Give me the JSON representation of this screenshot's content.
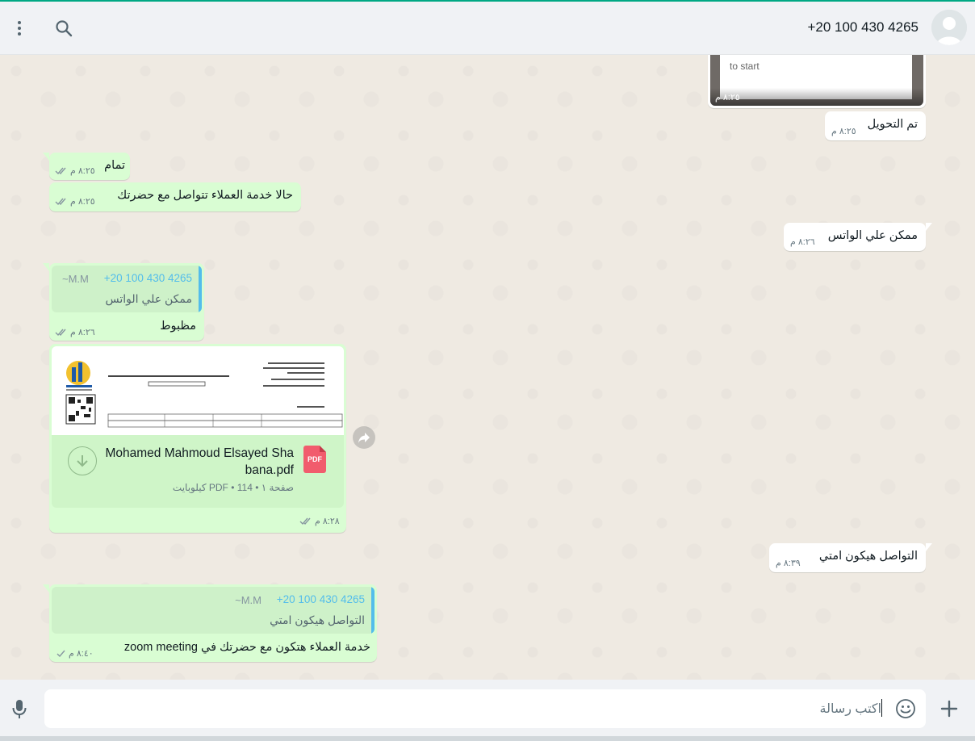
{
  "header": {
    "contact_name": "+20 100 430 4265"
  },
  "icons": {
    "avatar": "default-user-avatar",
    "menu": "kebab-menu-icon",
    "search": "search-icon",
    "mic": "microphone-icon",
    "add": "plus-icon",
    "emoji": "emoji-icon",
    "forward": "forward-icon",
    "download": "download-icon",
    "pdf": "pdf-file-icon",
    "read_receipt": "double-check-icon",
    "sent_receipt": "single-check-icon"
  },
  "colors": {
    "accent": "#00a884",
    "incoming": "#ffffff",
    "outgoing": "#d9fdd3",
    "quote_accent": "#53bdeb",
    "read_tick": "#8696a0",
    "pdf_red": "#f15c6d"
  },
  "messages": {
    "m1": {
      "image_caption": "to start",
      "time": "٨:٢٥ م"
    },
    "m2": {
      "text": "تم التحويل",
      "time": "٨:٢٥ م"
    },
    "m3": {
      "text": "تمام",
      "time": "٨:٢٥ م"
    },
    "m4": {
      "text": "حالا خدمة العملاء تتواصل مع حضرتك",
      "time": "٨:٢٥ م"
    },
    "m5": {
      "text": "ممكن علي الواتس",
      "time": "٨:٢٦ م"
    },
    "m6": {
      "quote": {
        "sender": "+20 100 430 4265",
        "alias": "~M.M",
        "text": "ممكن علي الواتس"
      },
      "text": "مظبوط",
      "time": "٨:٢٦ م"
    },
    "m7": {
      "file_name_line1": "Mohamed Mahmoud Elsayed Sha",
      "file_name_line2": "bana.pdf",
      "file_info": "صفحة ١ • PDF • 114 كيلوبايت",
      "pdf_badge": "PDF",
      "time": "٨:٢٨ م"
    },
    "m8": {
      "text": "التواصل هيكون امتي",
      "time": "٨:٣٩ م"
    },
    "m9": {
      "quote": {
        "sender": "+20 100 430 4265",
        "alias": "~M.M",
        "text": "التواصل هيكون امتي"
      },
      "text": "خدمة العملاء هتكون مع حضرتك في zoom meeting",
      "time": "٨:٤٠ م"
    }
  },
  "composer": {
    "placeholder": "اكتب رسالة"
  }
}
